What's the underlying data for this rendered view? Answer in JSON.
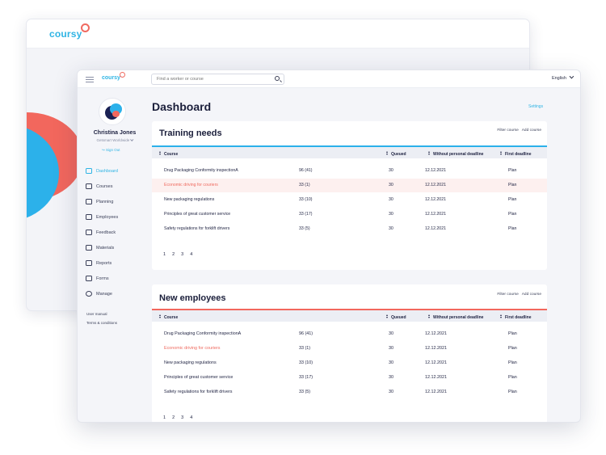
{
  "back_window": {
    "logo": "coursy"
  },
  "topbar": {
    "logo": "coursy",
    "search_placeholder": "Find a worker or course",
    "language": "English"
  },
  "user": {
    "name": "Christina Jones",
    "organization": "Getsmart Worldwide",
    "sign_out": "Sign Out"
  },
  "nav": [
    {
      "label": "Dashboard",
      "icon": "grid-icon",
      "active": true
    },
    {
      "label": "Courses",
      "icon": "book-icon"
    },
    {
      "label": "Planning",
      "icon": "calendar-icon"
    },
    {
      "label": "Employees",
      "icon": "people-icon"
    },
    {
      "label": "Feedback",
      "icon": "chat-icon"
    },
    {
      "label": "Materials",
      "icon": "document-icon"
    },
    {
      "label": "Reports",
      "icon": "report-icon"
    },
    {
      "label": "Forms",
      "icon": "form-icon"
    },
    {
      "label": "Manage",
      "icon": "gear-icon"
    }
  ],
  "footer_links": [
    "User manual",
    "Terms & conditions"
  ],
  "page": {
    "title": "Dashboard",
    "settings": "Settings"
  },
  "columns": [
    "Course",
    "Queued",
    "Without personal deadline",
    "First deadline"
  ],
  "training_needs": {
    "title": "Training needs",
    "filter": "Filter course",
    "add": "Add course",
    "rows": [
      {
        "course": "Drug Packaging Conformity inspectionA",
        "count": "96 (41)",
        "queued": "30",
        "deadline": "12.12.2021",
        "first": "Plan"
      },
      {
        "course": "Economic driving for couriers",
        "count": "33 (1)",
        "queued": "30",
        "deadline": "12.12.2021",
        "first": "Plan"
      },
      {
        "course": "New packaging regulations",
        "count": "33 (10)",
        "queued": "30",
        "deadline": "12.12.2021",
        "first": "Plan"
      },
      {
        "course": "Principles of great customer service",
        "count": "33 (17)",
        "queued": "30",
        "deadline": "12.12.2021",
        "first": "Plan"
      },
      {
        "course": "Safety regulations for forklift drivers",
        "count": "33 (5)",
        "queued": "30",
        "deadline": "12.12.2021",
        "first": "Plan"
      }
    ],
    "pages": [
      "1",
      "2",
      "3",
      "4"
    ]
  },
  "new_employees": {
    "title": "New employees",
    "filter": "Filter course",
    "add": "Add course",
    "rows": [
      {
        "course": "Drug Packaging Conformity inspectionA",
        "count": "96 (41)",
        "queued": "30",
        "deadline": "12.12.2021",
        "first": "Plan"
      },
      {
        "course": "Economic driving for couriers",
        "count": "33 (1)",
        "queued": "30",
        "deadline": "12.12.2021",
        "first": "Plan"
      },
      {
        "course": "New packaging regulations",
        "count": "33 (10)",
        "queued": "30",
        "deadline": "12.12.2021",
        "first": "Plan"
      },
      {
        "course": "Principles of great customer service",
        "count": "33 (17)",
        "queued": "30",
        "deadline": "12.12.2021",
        "first": "Plan"
      },
      {
        "course": "Safety regulations for forklift drivers",
        "count": "33 (5)",
        "queued": "30",
        "deadline": "12.12.2021",
        "first": "Plan"
      }
    ],
    "pages": [
      "1",
      "2",
      "3",
      "4"
    ]
  },
  "colors": {
    "accent": "#2cb1ea",
    "alert": "#f2675d",
    "navy": "#1b2154"
  }
}
